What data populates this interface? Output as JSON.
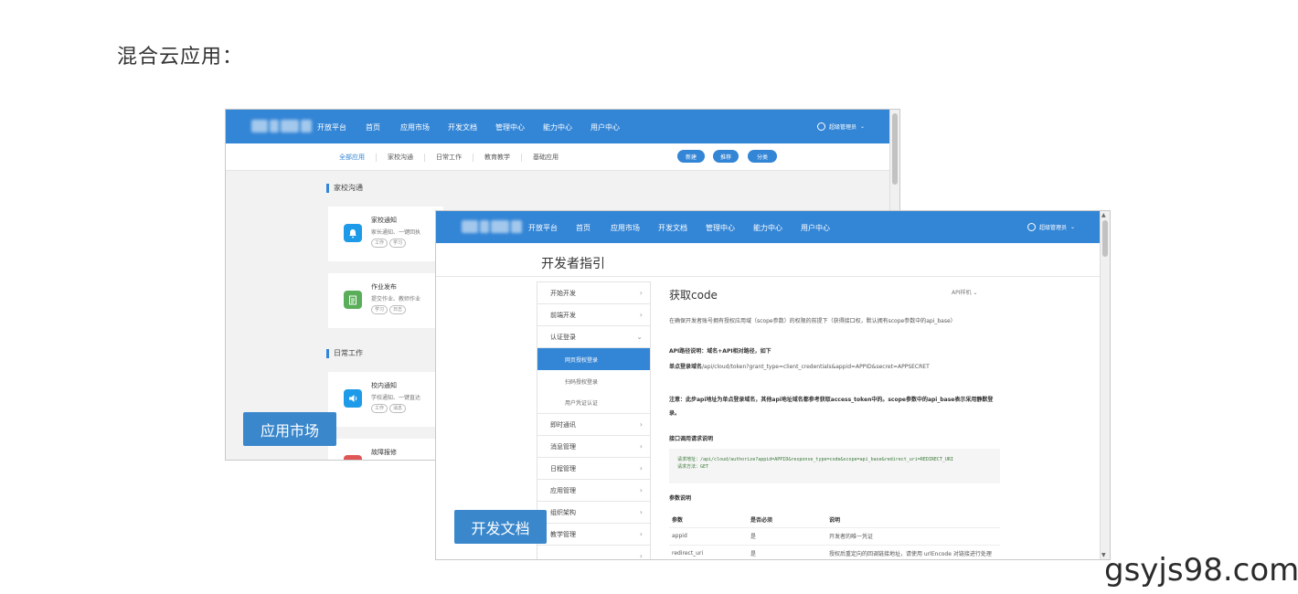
{
  "heading": "混合云应用：",
  "market": {
    "nav": {
      "platform": "开放平台",
      "items": [
        "首页",
        "应用市场",
        "开发文档",
        "管理中心",
        "能力中心",
        "用户中心"
      ],
      "user": "超级管理员"
    },
    "tabs": [
      "全部应用",
      "家校沟通",
      "日常工作",
      "教育教学",
      "基础应用"
    ],
    "buttons": [
      "新建",
      "推荐",
      "分类"
    ],
    "sections": [
      {
        "title": "家校沟通",
        "cards": [
          {
            "title": "家校通知",
            "desc": "家长通知、一键回执",
            "tags": [
              "工作",
              "学习"
            ],
            "icon": "bell-icon",
            "color": "#1e9be8"
          },
          {
            "title": "作业发布",
            "desc": "提交作业、教师作业",
            "tags": [
              "学习",
              "日志"
            ],
            "icon": "notebook-icon",
            "color": "#5aae5a"
          }
        ]
      },
      {
        "title": "日常工作",
        "cards": [
          {
            "title": "校内通知",
            "desc": "学校通知、一键直达",
            "tags": [
              "工作",
              "消息"
            ],
            "icon": "speaker-icon",
            "color": "#1e9be8"
          },
          {
            "title": "故障报修",
            "desc": "",
            "tags": [],
            "icon": "repair-icon",
            "color": "#e05555"
          }
        ]
      }
    ],
    "badge": "应用市场"
  },
  "docs": {
    "nav": {
      "platform": "开放平台",
      "items": [
        "首页",
        "应用市场",
        "开发文档",
        "管理中心",
        "能力中心",
        "用户中心"
      ],
      "user": "超级管理员"
    },
    "page_title": "开发者指引",
    "menu": [
      {
        "label": "开始开发",
        "arrow": "›"
      },
      {
        "label": "前端开发",
        "arrow": "›"
      },
      {
        "label": "认证登录",
        "arrow": "⌄",
        "children": [
          {
            "label": "网页授权登录",
            "active": true
          },
          {
            "label": "扫码授权登录",
            "active": false
          },
          {
            "label": "用户凭证认证",
            "active": false
          }
        ]
      },
      {
        "label": "即时通讯",
        "arrow": "›"
      },
      {
        "label": "消息管理",
        "arrow": "›"
      },
      {
        "label": "日程管理",
        "arrow": "›"
      },
      {
        "label": "应用管理",
        "arrow": "›"
      },
      {
        "label": "组织架构",
        "arrow": "›"
      },
      {
        "label": "教学管理",
        "arrow": "›"
      },
      {
        "label": "",
        "arrow": "›"
      }
    ],
    "content": {
      "title": "获取code",
      "dropdown": "API样机",
      "intro": "在确保开发者账号拥有授权应用域（scope参数）的权限的前提下（获得接口权，默认拥有scope参数中的api_base）",
      "api_path_label": "API路径说明：域名+API相对路径，如下",
      "api_path_prefix": "单点登录域名",
      "api_path_value": "/api/cloud/token?grant_type=client_credentials&appid=APPID&secret=APPSECRET",
      "note": "注意：此步api地址为单点登录域名，其他api地址域名都参考获取access_token中的。scope参数中的api_base表示采用静默登",
      "note_tail": "录。",
      "request_heading": "接口调用请求说明",
      "request_url": "请求地址：/api/cloud/authorize?appid=APPID&response_type=code&scope=api_base&redirect_uri=REDIRECT_URI",
      "request_method": "请求方法：GET",
      "params_heading": "参数说明",
      "table": {
        "headers": [
          "参数",
          "是否必须",
          "说明"
        ],
        "rows": [
          [
            "appid",
            "是",
            "开发者的唯一凭证"
          ],
          [
            "redirect_uri",
            "是",
            "授权后重定向的回调链接地址，请使用 urlEncode 对链接进行处理"
          ]
        ]
      }
    },
    "badge": "开发文档"
  },
  "watermark": "gsyjs98.com"
}
